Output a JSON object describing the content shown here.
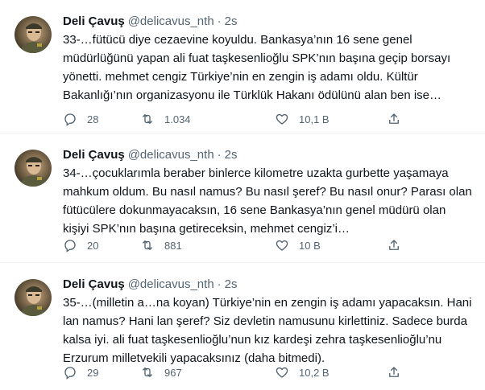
{
  "tweets": [
    {
      "author_name": "Deli Çavuş",
      "handle": "@delicavus_nth",
      "separator": "·",
      "time": "2s",
      "text": "33-…fütücü diye cezaevine koyuldu. Bankasya’nın 16 sene genel müdürlüğünü yapan ali fuat taşkesenlioğlu SPK’nın başına geçip borsayı yönetti. mehmet cengiz Türkiye’nin en zengin iş adamı oldu. Kültür Bakanlığı’nın organizasyonu ile Türklük Hakanı ödülünü alan ben ise…",
      "replies": "28",
      "retweets": "1.034",
      "likes": "10,1 B"
    },
    {
      "author_name": "Deli Çavuş",
      "handle": "@delicavus_nth",
      "separator": "·",
      "time": "2s",
      "text": "34-…çocuklarımla beraber binlerce kilometre uzakta gurbette yaşamaya mahkum oldum. Bu nasıl namus? Bu nasıl şeref? Bu nasıl onur? Parası olan fütücülere dokunmayacaksın, 16 sene Bankasya’nın genel müdürü olan kişiyi SPK’nın başına getireceksin, mehmet cengiz’i…",
      "replies": "20",
      "retweets": "881",
      "likes": "10 B"
    },
    {
      "author_name": "Deli Çavuş",
      "handle": "@delicavus_nth",
      "separator": "·",
      "time": "2s",
      "text": "35-…(milletin a…na koyan) Türkiye’nin en zengin iş adamı yapacaksın. Hani lan namus? Hani lan şeref? Siz devletin namusunu kirlettiniz. Sadece burda kalsa iyi. ali fuat taşkesenlioğlu’nun kız kardeşi zehra taşkesenlioğlu’nu Erzurum milletvekili yapacaksınız (daha bitmedi).",
      "replies": "29",
      "retweets": "967",
      "likes": "10,2 B"
    }
  ],
  "icons": {
    "avatar": "profile-photo",
    "reply": "reply-icon",
    "retweet": "retweet-icon",
    "like": "heart-icon",
    "share": "share-icon"
  },
  "colors": {
    "text": "#0f1419",
    "muted": "#536471",
    "divider": "#eff3f4"
  }
}
